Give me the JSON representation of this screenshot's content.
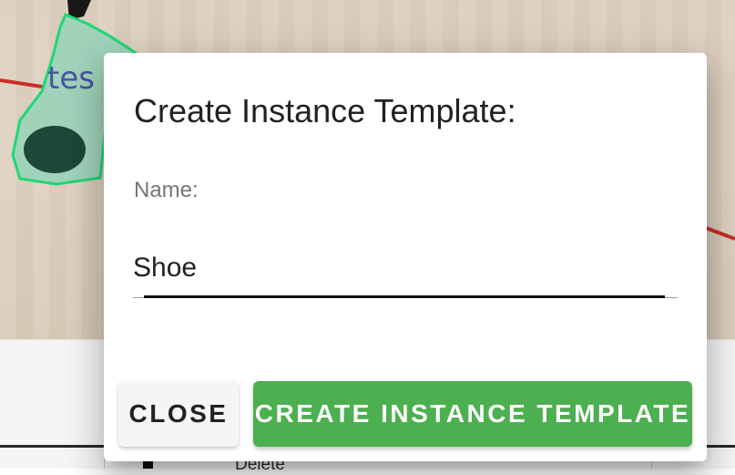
{
  "background": {
    "overlay_label_fragment": "tes",
    "list_item_label": "Delete"
  },
  "dialog": {
    "title": "Create Instance Template:",
    "name_label": "Name:",
    "name_value": "Shoe",
    "close_label": "CLOSE",
    "create_label": "CREATE INSTANCE TEMPLATE"
  },
  "colors": {
    "primary_button": "#4caf50",
    "annotation_outline": "#22e07a",
    "floor_line": "#d2302a"
  }
}
